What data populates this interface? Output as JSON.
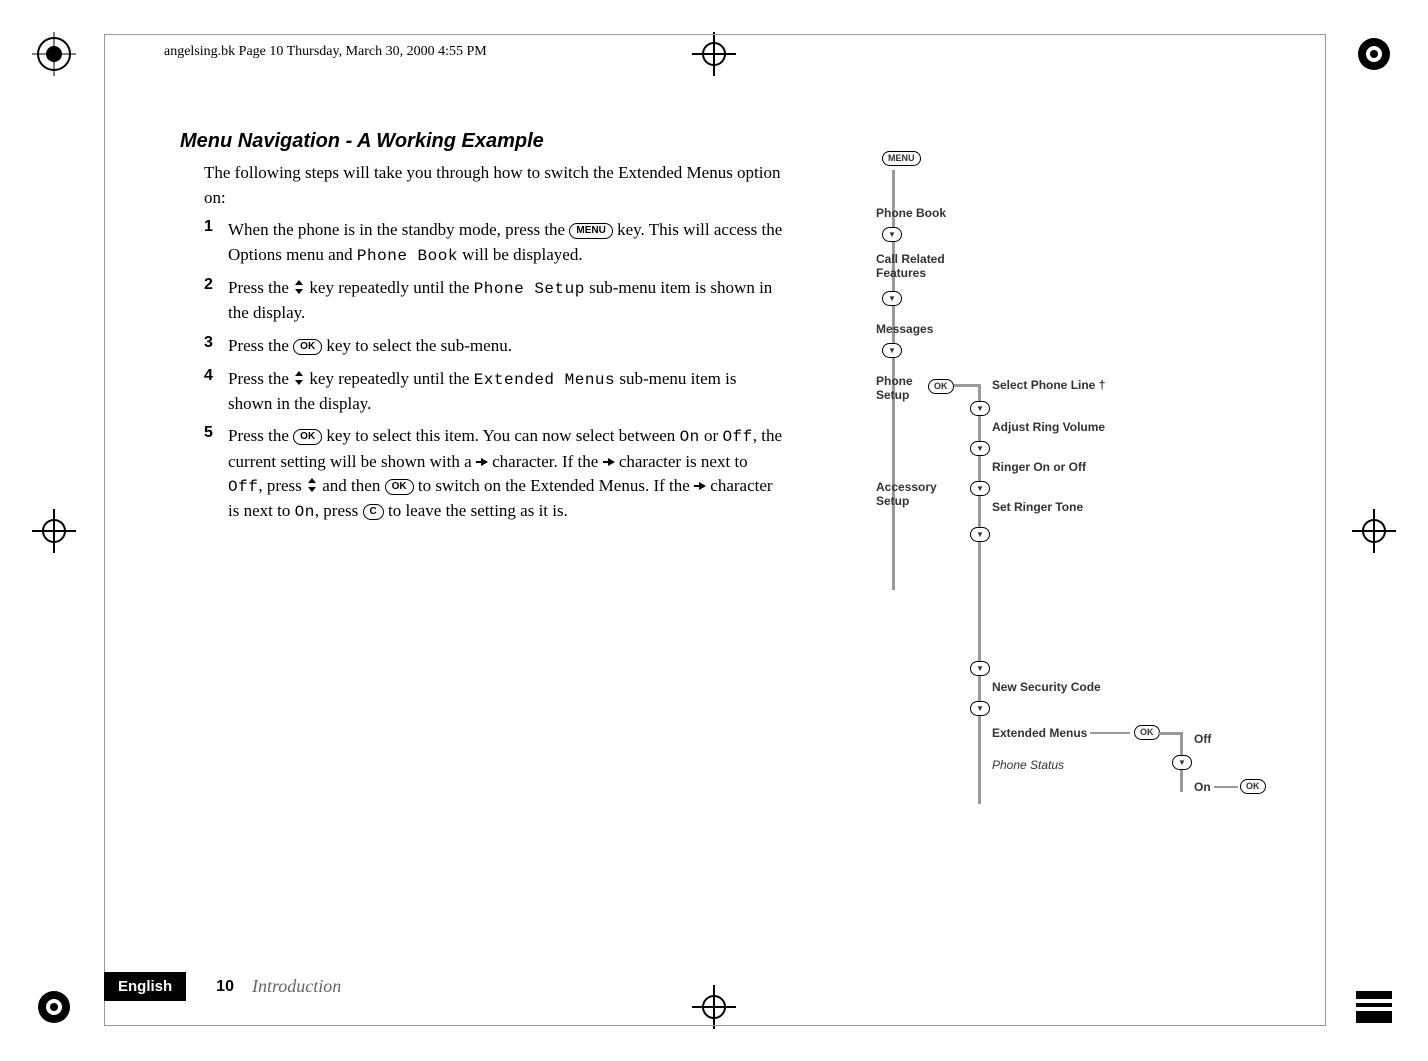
{
  "print_caption": "angelsing.bk  Page 10  Thursday, March 30, 2000  4:55 PM",
  "heading": "Menu Navigation - A Working Example",
  "intro": "The following steps will take you through how to switch the Extended Menus option on:",
  "steps": [
    {
      "num": "1",
      "pre": "When the phone is in the standby mode, press the ",
      "key": "MENU",
      "mid": " key. This will access the Options menu and ",
      "code": "Phone Book",
      "post": " will be displayed."
    },
    {
      "num": "2",
      "pre": "Press the ",
      "icon": "nav",
      "mid": " key repeatedly until the ",
      "code": "Phone Setup",
      "post": " sub-menu item is shown in the display."
    },
    {
      "num": "3",
      "pre": "Press the ",
      "key": "OK",
      "post": " key to select the sub-menu."
    },
    {
      "num": "4",
      "pre": "Press the ",
      "icon": "nav",
      "mid": " key repeatedly until the ",
      "code": "Extended Menus",
      "post": " sub-menu item is shown in the display."
    },
    {
      "num": "5",
      "pre": "Press the ",
      "key": "OK",
      "mid": " key to select this item. You can now select between ",
      "code1": "On",
      "mid2": " or ",
      "code2": "Off",
      "mid3": ", the current setting will be shown with a ",
      "arrow1": true,
      "mid4": " character. If the ",
      "arrow2": true,
      "mid5": " character is next to ",
      "code3": "Off",
      "mid6": ", press ",
      "icon2": "nav",
      "mid7": " and then ",
      "key2": "OK",
      "mid8": " to switch on the Extended Menus. If the ",
      "arrow3": true,
      "mid9": " character is next to ",
      "code4": "On",
      "mid10": ", press ",
      "key3": "C",
      "post": " to leave the setting as it is."
    }
  ],
  "footer": {
    "language": "English",
    "page": "10",
    "section": "Introduction"
  },
  "diagram": {
    "menu_key": "MENU",
    "ok_key": "OK",
    "items_main": [
      "Phone Book",
      "Call Related Features",
      "Messages",
      "Phone Setup",
      "Accessory Setup"
    ],
    "items_sub": [
      "Select Phone Line †",
      "Adjust Ring Volume",
      "Ringer On or Off",
      "Set Ringer Tone",
      "New Security Code",
      "Extended Menus",
      "Phone Status"
    ],
    "options": [
      "Off",
      "On"
    ]
  }
}
